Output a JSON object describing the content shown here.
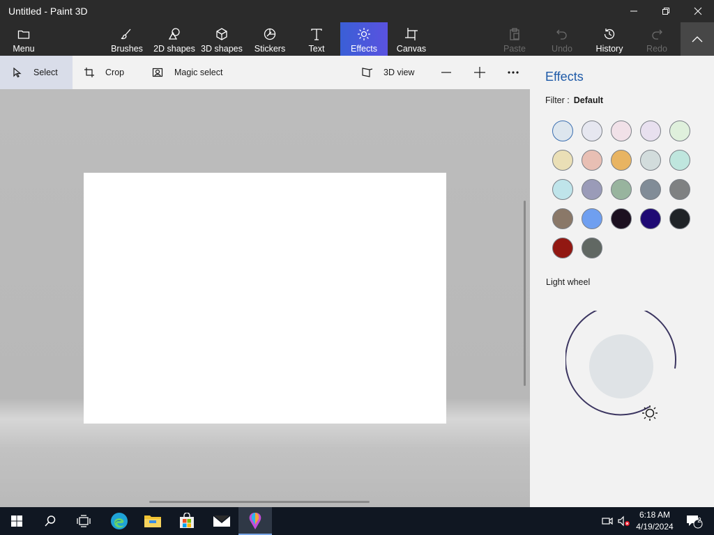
{
  "window": {
    "title": "Untitled - Paint 3D"
  },
  "ribbon": {
    "menu_label": "Menu",
    "tools": [
      {
        "label": "Brushes",
        "icon": "brush-icon"
      },
      {
        "label": "2D shapes",
        "icon": "2d-shapes-icon"
      },
      {
        "label": "3D shapes",
        "icon": "3d-shapes-icon"
      },
      {
        "label": "Stickers",
        "icon": "stickers-icon"
      },
      {
        "label": "Text",
        "icon": "text-icon"
      },
      {
        "label": "Effects",
        "icon": "effects-icon",
        "active": true
      },
      {
        "label": "Canvas",
        "icon": "canvas-icon"
      }
    ],
    "paste_label": "Paste",
    "undo_label": "Undo",
    "history_label": "History",
    "redo_label": "Redo",
    "accent_color": "#4a58dc"
  },
  "toolbar": {
    "select_label": "Select",
    "crop_label": "Crop",
    "magic_select_label": "Magic select",
    "view3d_label": "3D view"
  },
  "effects_panel": {
    "title": "Effects",
    "filter_label": "Filter :",
    "filter_value": "Default",
    "swatches": [
      "#dde6ee",
      "#e6e7f0",
      "#f1e1e8",
      "#e8e0ef",
      "#dff0dc",
      "#eadfb6",
      "#e8bfb4",
      "#e8b462",
      "#d2dcdc",
      "#bfe6de",
      "#bfe4ea",
      "#9a9bb8",
      "#98b49e",
      "#818c97",
      "#7f8182",
      "#8a7868",
      "#6f9ff0",
      "#1c1020",
      "#1f0a74",
      "#1f2327",
      "#921812",
      "#616863"
    ],
    "light_wheel_label": "Light wheel"
  },
  "taskbar": {
    "apps": [
      "windows-start-icon",
      "search-icon",
      "task-view-icon",
      "edge-icon",
      "file-explorer-icon",
      "store-icon",
      "mail-icon",
      "paint3d-icon"
    ],
    "time": "6:18 AM",
    "date": "4/19/2024",
    "notification_count": "2"
  }
}
